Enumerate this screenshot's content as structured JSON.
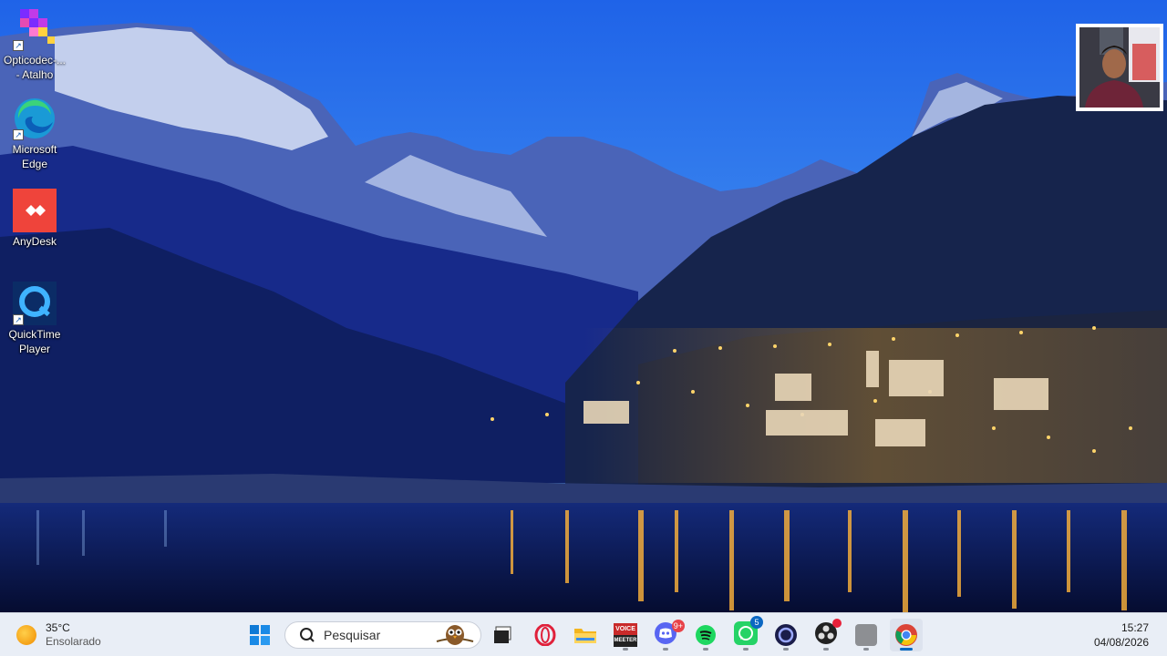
{
  "desktop": {
    "icons": [
      {
        "label": "Opticodec-... - Atalho",
        "icon": "opticodec-icon",
        "shortcut": true
      },
      {
        "label": "Microsoft Edge",
        "icon": "edge-icon",
        "shortcut": true
      },
      {
        "label": "AnyDesk",
        "icon": "anydesk-icon",
        "shortcut": false
      },
      {
        "label": "QuickTime Player",
        "icon": "quicktime-icon",
        "shortcut": true
      }
    ],
    "wallpaper": "mountain-lake-village-night"
  },
  "taskbar": {
    "weather": {
      "temp": "35°C",
      "condition": "Ensolarado",
      "icon": "sun-icon"
    },
    "search": {
      "placeholder": "Pesquisar"
    },
    "apps": [
      {
        "name": "start",
        "icon": "windows-start-icon"
      },
      {
        "name": "search",
        "icon": "search-icon"
      },
      {
        "name": "task-view",
        "icon": "task-view-icon"
      },
      {
        "name": "opera",
        "icon": "opera-icon"
      },
      {
        "name": "file-explorer",
        "icon": "folder-icon"
      },
      {
        "name": "voicemeeter",
        "icon": "voicemeeter-icon",
        "text_top": "VOICE",
        "text_bottom": "MEETER"
      },
      {
        "name": "discord",
        "icon": "discord-icon",
        "badge": "9+"
      },
      {
        "name": "spotify",
        "icon": "spotify-icon"
      },
      {
        "name": "whatsapp",
        "icon": "whatsapp-icon",
        "badge": "5"
      },
      {
        "name": "app-circle",
        "icon": "circle-app-icon"
      },
      {
        "name": "obs",
        "icon": "obs-icon"
      },
      {
        "name": "gray-app",
        "icon": "gray-app-icon"
      },
      {
        "name": "chrome",
        "icon": "chrome-icon",
        "active": true
      }
    ],
    "clock": {
      "time": "15:27",
      "date": "04/08/2026"
    }
  },
  "colors": {
    "taskbar_bg": "#e9eef6",
    "accent": "#0067c0",
    "sky": "#2a6fe0"
  }
}
